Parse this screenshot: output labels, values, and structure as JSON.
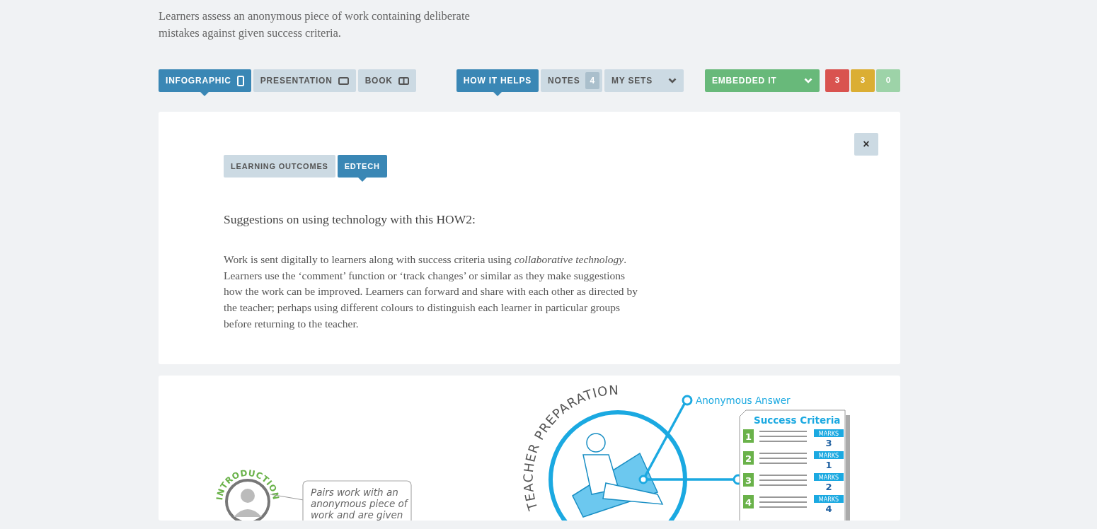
{
  "intro": "Learners assess an anonymous piece of work containing deliberate mistakes against given success criteria.",
  "view_tabs": [
    {
      "label": "INFOGRAPHIC",
      "kind": "portrait",
      "selected": true
    },
    {
      "label": "PRESENTATION",
      "kind": "landscape",
      "selected": false
    },
    {
      "label": "BOOK",
      "kind": "book",
      "selected": false
    }
  ],
  "help_tabs": [
    {
      "label": "HOW IT HELPS",
      "kind": "plain",
      "selected": true
    },
    {
      "label": "NOTES",
      "kind": "count",
      "count": "4",
      "selected": false
    },
    {
      "label": "MY SETS",
      "kind": "dropdown",
      "selected": false
    }
  ],
  "embed_dropdown": "EMBEDDED IT",
  "counters": [
    {
      "value": "3",
      "color": "#d9534f"
    },
    {
      "value": "3",
      "color": "#dbae33"
    },
    {
      "value": "0",
      "color": "#9dd3a8"
    }
  ],
  "panel": {
    "close": "×",
    "tabs": [
      {
        "label": "LEARNING OUTCOMES",
        "selected": false
      },
      {
        "label": "EDTECH",
        "selected": true
      }
    ],
    "heading": "Suggestions on using technology with this HOW2:",
    "body": "Work is sent digitally to learners along with success criteria using *collaborative technology*. Learners use the ‘comment’ function or ‘track changes’ or similar as they make suggestions how the work can be improved. Learners can forward and share with each other as directed by the teacher; perhaps using different colours to distinguish each learner in particular groups before returning to the teacher."
  },
  "infographic": {
    "intro_label": "INTRODUCTION",
    "bubble_lines": [
      "Pairs work with an",
      "anonymous piece of",
      "work and are given"
    ],
    "section_title": "TEACHER PREPARATION",
    "callout": "Anonymous Answer",
    "criteria_title": "Success Criteria",
    "criteria": [
      {
        "number": "1",
        "marks_label": "MARKS",
        "marks": "3"
      },
      {
        "number": "2",
        "marks_label": "MARKS",
        "marks": "1"
      },
      {
        "number": "3",
        "marks_label": "MARKS",
        "marks": "2"
      },
      {
        "number": "4",
        "marks_label": "MARKS",
        "marks": "4"
      }
    ]
  }
}
